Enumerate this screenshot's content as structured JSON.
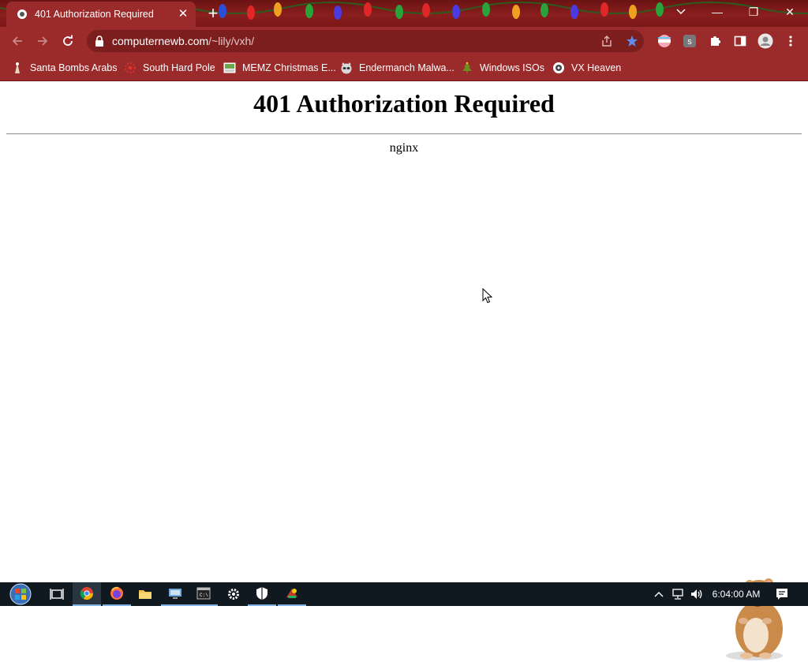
{
  "browser": {
    "tab": {
      "title": "401 Authorization Required",
      "close_glyph": "✕"
    },
    "new_tab_glyph": "+",
    "window_controls": {
      "tab_search_icon": "chevron-down-icon",
      "minimize_glyph": "—",
      "restore_glyph": "❐",
      "close_glyph": "✕"
    },
    "address_bar": {
      "host": "computernewb.com",
      "path": "/~lily/vxh/"
    },
    "bookmarks": [
      {
        "label": "Santa Bombs Arabs",
        "icon": "santa-icon"
      },
      {
        "label": "South Hard Pole",
        "icon": "snowflake-icon"
      },
      {
        "label": "MEMZ Christmas E...",
        "icon": "memz-icon"
      },
      {
        "label": "Endermanch Malwa...",
        "icon": "raccoon-icon"
      },
      {
        "label": "Windows ISOs",
        "icon": "tree-icon"
      },
      {
        "label": "VX Heaven",
        "icon": "vx-heaven-icon"
      }
    ]
  },
  "page": {
    "heading": "401 Authorization Required",
    "server": "nginx"
  },
  "taskbar": {
    "clock": "6:04:00 AM"
  },
  "colors": {
    "chrome_red": "#9b2a2a",
    "chrome_dark_red": "#6a1313",
    "bookmark_star": "#5b8def",
    "taskbar": "#101820"
  }
}
